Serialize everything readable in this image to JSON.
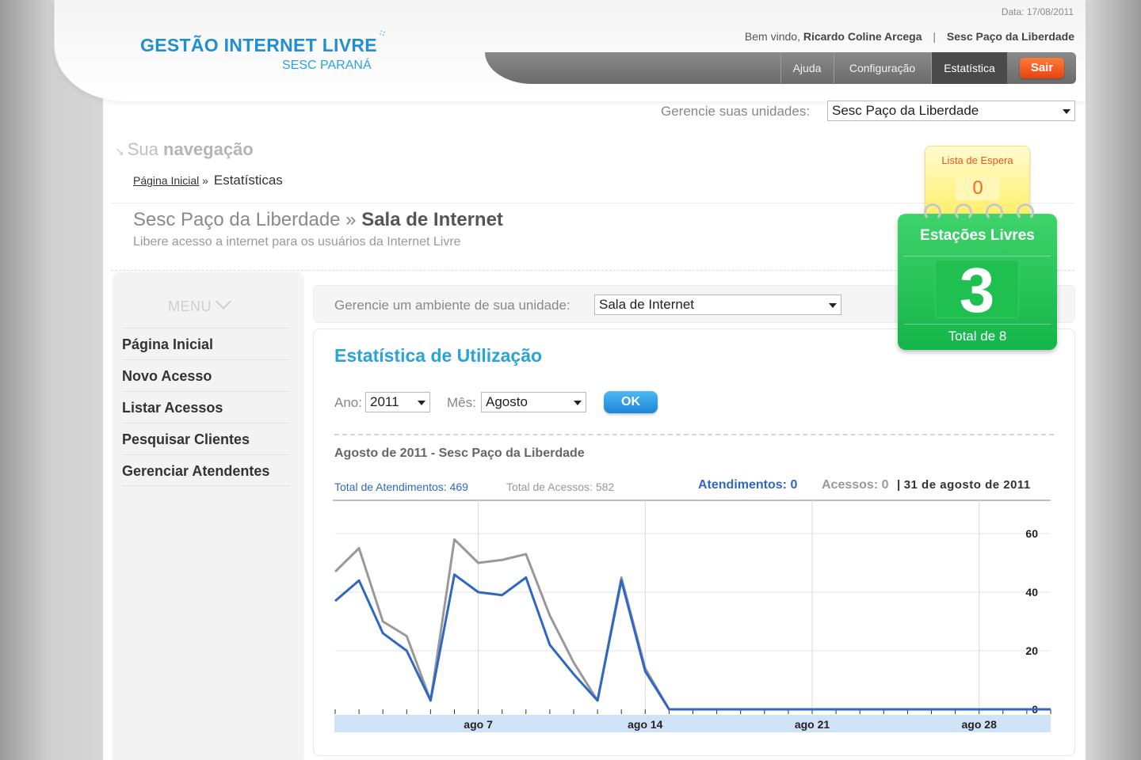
{
  "header": {
    "logo_line1": "GESTÃO INTERNET LIVRE",
    "logo_line2": "SESC PARANÁ",
    "date": "Data: 17/08/2011",
    "welcome_prefix": "Bem vindo,",
    "user_name": "Ricardo Coline Arcega",
    "separator": "|",
    "unit_name": "Sesc Paço da Liberdade"
  },
  "nav": {
    "ajuda": "Ajuda",
    "configuracao": "Configuração",
    "estatistica": "Estatística",
    "sair": "Sair"
  },
  "unit_selector": {
    "label": "Gerencie suas unidades:",
    "selected": "Sesc Paço da Liberdade"
  },
  "navigation": {
    "label_light": "Sua",
    "label_bold": "navegação",
    "breadcrumb_home": "Página Inicial",
    "breadcrumb_sep": "»",
    "breadcrumb_current": "Estatísticas"
  },
  "page": {
    "title_unit": "Sesc Paço da Liberdade »",
    "title_section": "Sala de Internet",
    "subtitle": "Libere acesso a internet para os usuários da Internet Livre"
  },
  "widgets": {
    "waitlist_label": "Lista de Espera",
    "waitlist_value": "0",
    "free_label": "Estações Livres",
    "free_value": "3",
    "free_total": "Total de 8"
  },
  "sidebar": {
    "title": "MENU",
    "items": [
      {
        "label": "Página Inicial"
      },
      {
        "label": "Novo Acesso"
      },
      {
        "label": "Listar Acessos"
      },
      {
        "label": "Pesquisar Clientes"
      },
      {
        "label": "Gerenciar Atendentes"
      }
    ]
  },
  "environment": {
    "label": "Gerencie um ambiente de sua unidade:",
    "selected": "Sala de Internet"
  },
  "stats": {
    "title": "Estatística de Utilização",
    "year_label": "Ano:",
    "year_value": "2011",
    "month_label": "Mês:",
    "month_value": "Agosto",
    "ok_label": "OK",
    "chart_heading": "Agosto de 2011 - Sesc Paço da Liberdade",
    "total_atendimentos": "Total de Atendimentos: 469",
    "total_acessos": "Total de Acessos: 582",
    "hover_atendimentos": "Atendimentos: 0",
    "hover_acessos": "Acessos: 0",
    "hover_sep": "|",
    "hover_date": "31 de agosto de 2011"
  },
  "colors": {
    "accent_blue": "#28a4dc",
    "series_atendimentos": "#2f67c3",
    "series_acessos": "#999999",
    "green": "#14b54a",
    "orange": "#e8430e"
  },
  "chart_data": {
    "type": "line",
    "x": [
      1,
      2,
      3,
      4,
      5,
      6,
      7,
      8,
      9,
      10,
      11,
      12,
      13,
      14,
      15,
      16,
      17,
      18,
      19,
      20,
      21,
      22,
      23,
      24,
      25,
      26,
      27,
      28,
      29,
      30,
      31
    ],
    "x_tick_labels": [
      "ago 7",
      "ago 14",
      "ago 21",
      "ago 28"
    ],
    "x_tick_values": [
      7,
      14,
      21,
      28
    ],
    "y_tick_labels": [
      "0",
      "20",
      "40",
      "60"
    ],
    "ylim": [
      0,
      60
    ],
    "grid": true,
    "series": [
      {
        "name": "Acessos",
        "color": "#999999",
        "values": [
          47,
          55,
          30,
          25,
          3,
          58,
          50,
          51,
          53,
          32,
          16,
          3,
          45,
          14,
          0,
          0,
          0,
          0,
          0,
          0,
          0,
          0,
          0,
          0,
          0,
          0,
          0,
          0,
          0,
          0,
          0
        ]
      },
      {
        "name": "Atendimentos",
        "color": "#2f67c3",
        "values": [
          37,
          44,
          26,
          20,
          3,
          46,
          40,
          39,
          45,
          22,
          12,
          3,
          44,
          13,
          0,
          0,
          0,
          0,
          0,
          0,
          0,
          0,
          0,
          0,
          0,
          0,
          0,
          0,
          0,
          0,
          0
        ]
      }
    ]
  }
}
